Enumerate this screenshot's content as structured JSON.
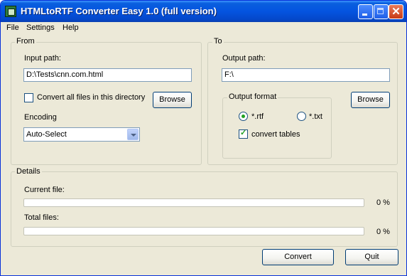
{
  "window": {
    "title": "HTMLtoRTF Converter Easy 1.0 (full version)"
  },
  "menu": [
    "File",
    "Settings",
    "Help"
  ],
  "from": {
    "legend": "From",
    "input_label": "Input path:",
    "input_value": "D:\\Tests\\cnn.com.html",
    "convert_all_label": "Convert all files in this directory",
    "convert_all_checked": false,
    "browse_label": "Browse",
    "encoding_label": "Encoding",
    "encoding_value": "Auto-Select"
  },
  "to": {
    "legend": "To",
    "output_label": "Output path:",
    "output_value": "F:\\",
    "browse_label": "Browse",
    "format_legend": "Output format",
    "rtf_label": "*.rtf",
    "txt_label": "*.txt",
    "selected_format": "rtf",
    "convert_tables_label": "convert tables",
    "convert_tables_checked": true
  },
  "details": {
    "legend": "Details",
    "current_file_label": "Current file:",
    "current_file_percent": "0 %",
    "current_file_progress": 0,
    "total_files_label": "Total files:",
    "total_files_percent": "0 %",
    "total_files_progress": 0
  },
  "buttons": {
    "convert": "Convert",
    "quit": "Quit"
  }
}
